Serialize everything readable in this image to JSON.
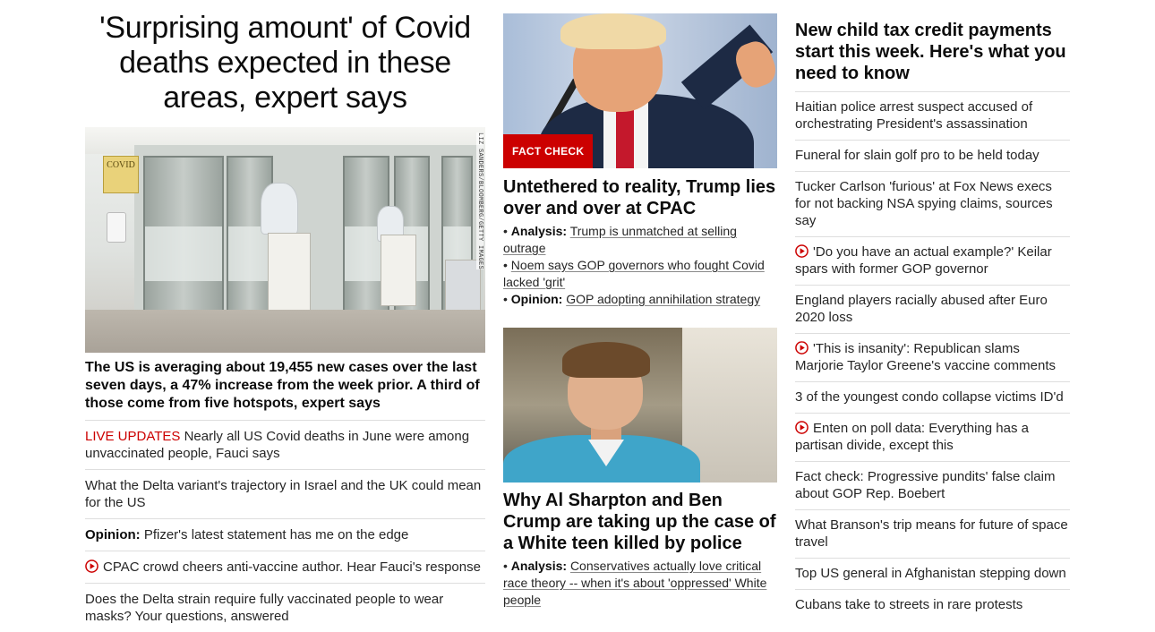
{
  "col1": {
    "headline": "'Surprising amount' of Covid deaths expected in these areas, expert says",
    "image": {
      "sign_text": "COVID",
      "credit": "LIZ SANDERS/BLOOMBERG/GETTY IMAGES"
    },
    "lead": "The US is averaging about 19,455 new cases over the last seven days, a 47% increase from the week prior. A third of those come from five hotspots, expert says",
    "items": [
      {
        "prefix": "LIVE UPDATES",
        "text": " Nearly all US Covid deaths in June were among unvaccinated people, Fauci says"
      },
      {
        "text": "What the Delta variant's trajectory in Israel and the UK could mean for the US"
      },
      {
        "prefix_bold": "Opinion:",
        "text": " Pfizer's latest statement has me on the edge"
      },
      {
        "text": "CPAC crowd cheers anti-vaccine author. Hear Fauci's response",
        "icon": "play-icon"
      },
      {
        "text": "Does the Delta strain require fully vaccinated people to wear masks? Your questions, answered"
      }
    ]
  },
  "col2": {
    "badge": "FACT CHECK",
    "headline1": "Untethered to reality, Trump lies over and over at CPAC",
    "bullets1": [
      {
        "prefix": "• ",
        "label": "Analysis:",
        "link": "Trump is unmatched at selling outrage"
      },
      {
        "prefix": "• ",
        "link": "Noem says GOP governors who fought Covid lacked 'grit'"
      },
      {
        "prefix": "• ",
        "label": "Opinion:",
        "link": "GOP adopting annihilation strategy"
      }
    ],
    "headline2": "Why Al Sharpton and Ben Crump are taking up the case of a White teen killed by police",
    "bullets2": [
      {
        "prefix": "• ",
        "label": "Analysis:",
        "link": "Conservatives actually love critical race theory -- when it's about 'oppressed' White people"
      }
    ]
  },
  "col3": {
    "headline": "New child tax credit payments start this week. Here's what you need to know",
    "items": [
      {
        "text": "Haitian police arrest suspect accused of orchestrating President's assassination"
      },
      {
        "text": "Funeral for slain golf pro to be held today"
      },
      {
        "text": "Tucker Carlson 'furious' at Fox News execs for not backing NSA spying claims, sources say"
      },
      {
        "text": "'Do you have an actual example?' Keilar spars with former GOP governor",
        "icon": "play-icon"
      },
      {
        "text": "England players racially abused after Euro 2020 loss"
      },
      {
        "text": "'This is insanity': Republican slams Marjorie Taylor Greene's vaccine comments",
        "icon": "play-icon"
      },
      {
        "text": "3 of the youngest condo collapse victims ID'd"
      },
      {
        "text": "Enten on poll data: Everything has a partisan divide, except this",
        "icon": "play-icon"
      },
      {
        "text": "Fact check: Progressive pundits' false claim about GOP Rep. Boebert"
      },
      {
        "text": "What Branson's trip means for future of space travel"
      },
      {
        "text": "Top US general in Afghanistan stepping down"
      },
      {
        "text": "Cubans take to streets in rare protests"
      }
    ]
  },
  "colors": {
    "accent_red": "#cc0000",
    "text": "#262626",
    "divider": "#dedede"
  }
}
